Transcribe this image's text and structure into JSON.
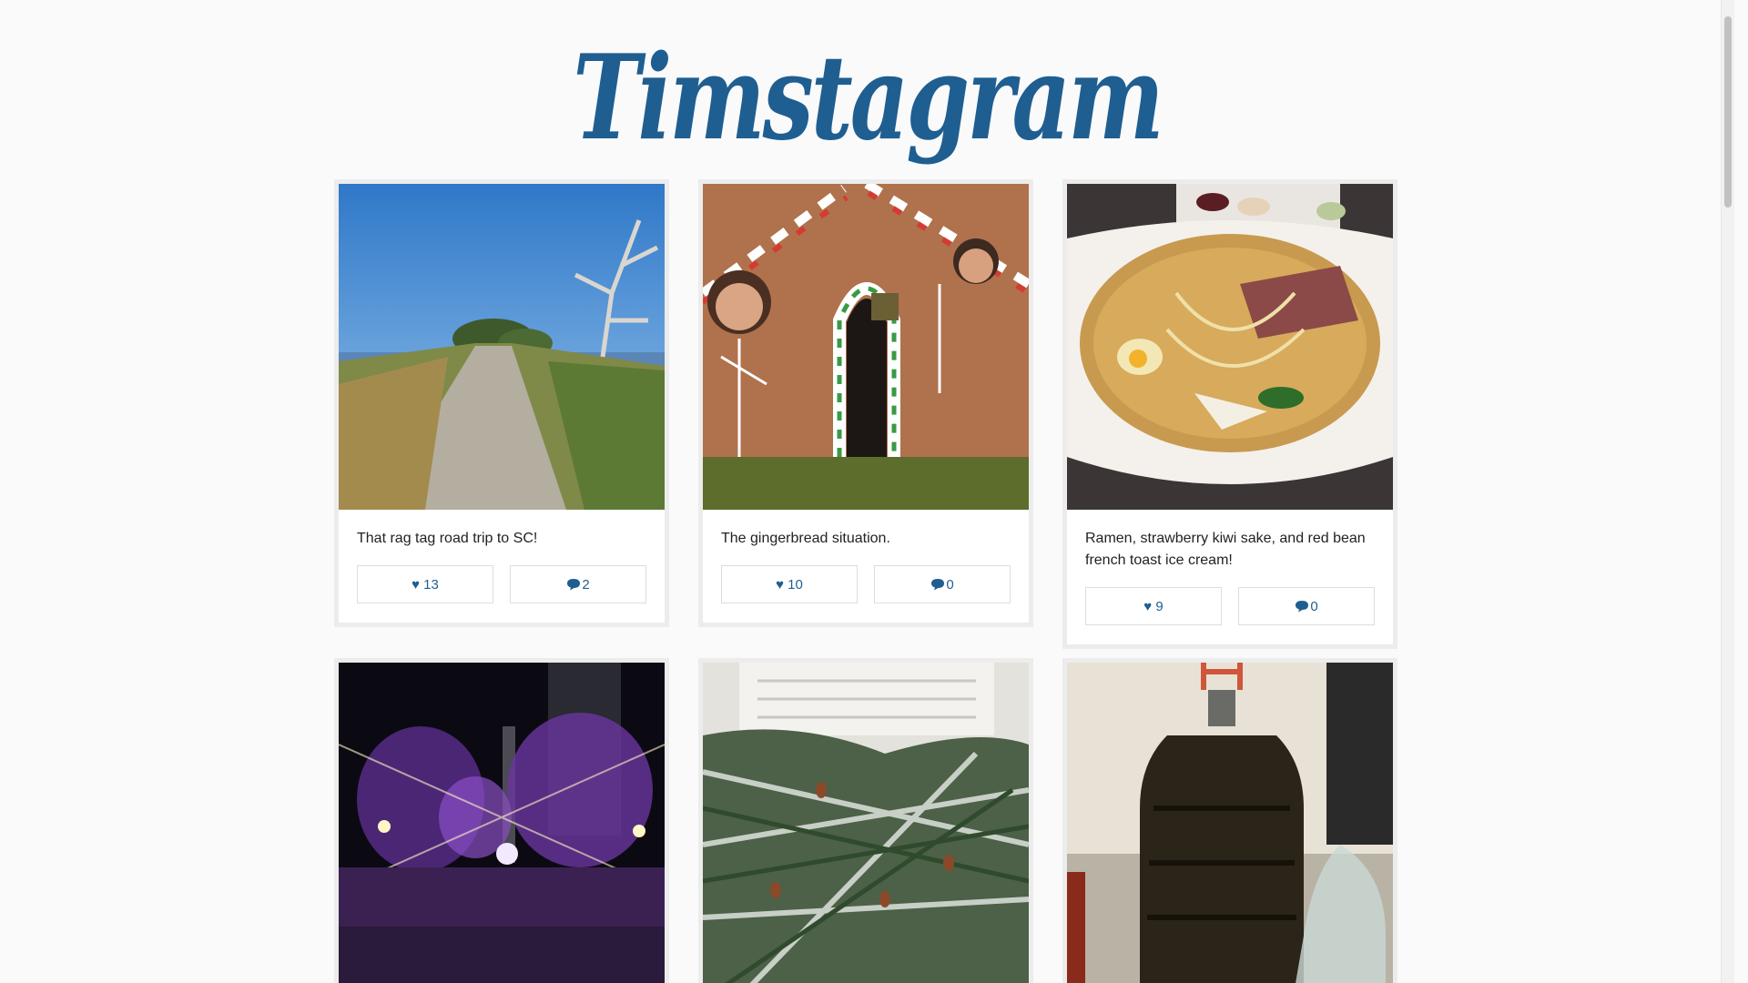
{
  "app": {
    "title": "Timstagram",
    "brand_color": "#1f5e91"
  },
  "posts": [
    {
      "caption": "That rag tag road trip to SC!",
      "likes": "♥ 13",
      "comments": "2",
      "image": "coastal-trail-photo"
    },
    {
      "caption": "The gingerbread situation.",
      "likes": "♥ 10",
      "comments": "0",
      "image": "gingerbread-cutout-photo"
    },
    {
      "caption": "Ramen, strawberry kiwi sake, and red bean french toast ice cream!",
      "likes": "♥ 9",
      "comments": "0",
      "image": "ramen-bowl-photo"
    },
    {
      "caption": "",
      "likes": "",
      "comments": "",
      "image": "purple-lights-photo"
    },
    {
      "caption": "",
      "likes": "",
      "comments": "",
      "image": "snowy-pine-photo"
    },
    {
      "caption": "",
      "likes": "",
      "comments": "",
      "image": "homebrew-carboy-photo"
    }
  ]
}
